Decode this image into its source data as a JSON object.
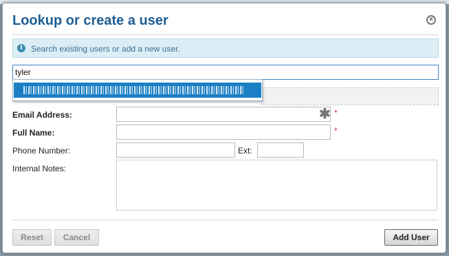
{
  "dialog": {
    "title": "Lookup or create a user",
    "info_text": "Search existing users or add a new user."
  },
  "search": {
    "value": "tyler",
    "suggestion_state": "highlighted (text obscured)"
  },
  "form": {
    "email_label": "Email Address:",
    "fullname_label": "Full Name:",
    "phone_label": "Phone Number:",
    "ext_label": "Ext:",
    "notes_label": "Internal Notes:",
    "required_mark": "*"
  },
  "buttons": {
    "reset": "Reset",
    "cancel": "Cancel",
    "add_user": "Add User"
  },
  "icons": {
    "close": "close-icon",
    "info": "info-icon",
    "asterisk": "asterisk-icon"
  },
  "colors": {
    "title": "#1e5e94",
    "info_bg": "#dbeef6",
    "highlight": "#1a7fc4",
    "required": "#c0392b"
  }
}
